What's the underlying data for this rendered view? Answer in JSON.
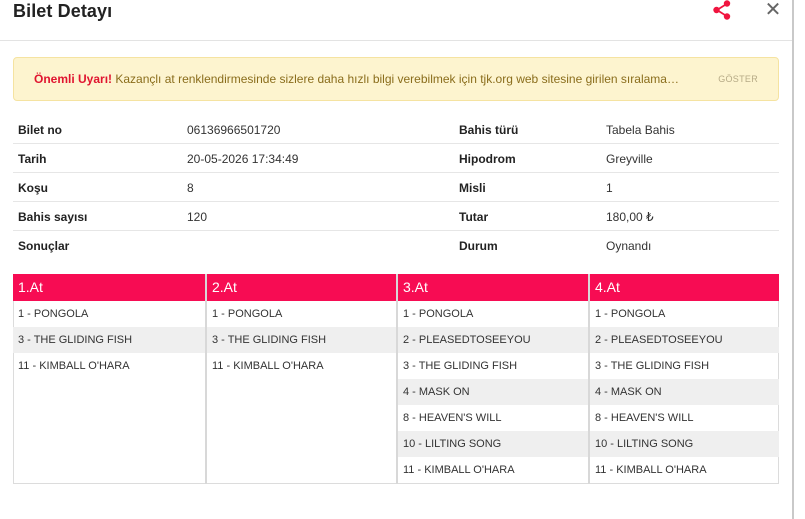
{
  "modal": {
    "title": "Bilet Detayı"
  },
  "alert": {
    "strong": "Önemli Uyarı!",
    "message": " Kazançlı at renklendirmesinde sizlere daha hızlı bilgi verebilmek için tjk.org web sitesine girilen sıralama…",
    "button": "GÖSTER"
  },
  "info": {
    "rows": [
      {
        "l1": "Bilet no",
        "v1": "06136966501720",
        "l2": "Bahis türü",
        "v2": "Tabela Bahis"
      },
      {
        "l1": "Tarih",
        "v1": "20-05-2026 17:34:49",
        "l2": "Hipodrom",
        "v2": "Greyville"
      },
      {
        "l1": "Koşu",
        "v1": "8",
        "l2": "Misli",
        "v2": "1"
      },
      {
        "l1": "Bahis sayısı",
        "v1": "120",
        "l2": "Tutar",
        "v2": "180,00 ₺"
      },
      {
        "l1": "Sonuçlar",
        "v1": "",
        "l2": "Durum",
        "v2": "Oynandı"
      }
    ]
  },
  "results": {
    "columns": [
      {
        "header": "1.At",
        "horses": [
          "1 - PONGOLA",
          "3 - THE GLIDING FISH",
          "11 - KIMBALL O'HARA"
        ]
      },
      {
        "header": "2.At",
        "horses": [
          "1 - PONGOLA",
          "3 - THE GLIDING FISH",
          "11 - KIMBALL O'HARA"
        ]
      },
      {
        "header": "3.At",
        "horses": [
          "1 - PONGOLA",
          "2 - PLEASEDTOSEEYOU",
          "3 - THE GLIDING FISH",
          "4 - MASK ON",
          "8 - HEAVEN'S WILL",
          "10 - LILTING SONG",
          "11 - KIMBALL O'HARA"
        ]
      },
      {
        "header": "4.At",
        "horses": [
          "1 - PONGOLA",
          "2 - PLEASEDTOSEEYOU",
          "3 - THE GLIDING FISH",
          "4 - MASK ON",
          "8 - HEAVEN'S WILL",
          "10 - LILTING SONG",
          "11 - KIMBALL O'HARA"
        ]
      }
    ]
  },
  "colors": {
    "accent": "#f70c53",
    "alert_bg": "#fdf4cf",
    "alert_strong": "#e0142f"
  },
  "icons": {
    "share": "share-icon",
    "close": "close-icon"
  }
}
